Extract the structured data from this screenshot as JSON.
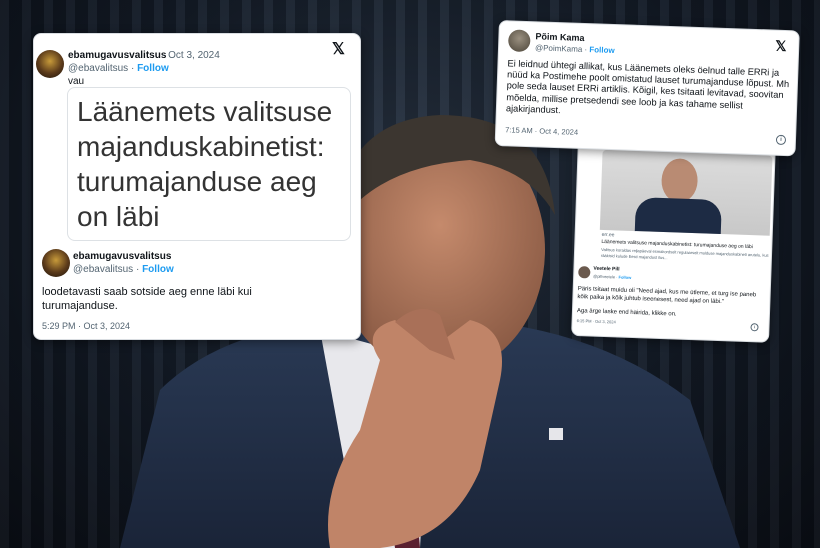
{
  "tweet_left": {
    "name": "ebamugavusvalitsus",
    "date": "Oct 3, 2024",
    "handle": "@ebavalitsus",
    "follow_label": "Follow",
    "text": "vau",
    "embedded_headline": "Läänemets valitsuse majanduskabinetist: turumajanduse aeg on läbi",
    "reply_name": "ebamugavusvalitsus",
    "reply_handle": "@ebavalitsus",
    "reply_follow": "Follow",
    "reply_text": "loodetavasti saab sotside aeg enne läbi kui turumajanduse.",
    "reply_time": "5:29 PM · Oct 3, 2024"
  },
  "tweet_right_top": {
    "name": "Põim Kama",
    "handle": "@PoimKama",
    "follow_label": "Follow",
    "text": "Ei leidnud ühtegi allikat, kus Läänemets oleks öelnud talle ERRi ja nüüd ka Postimehe poolt omistatud lauset turumajanduse lõpust. Mh pole seda lauset ERRi artiklis. Kõigil, kes tsitaati levitavad, soovitan mõelda, millise pretsedendi see loob ja kas tahame sellist ajakirjandust.",
    "time": "7:15 AM · Oct 4, 2024"
  },
  "tweet_right_bottom": {
    "embed_source": "err.ee",
    "embed_title": "Läänemets valitsuse majanduskabinetist: turumajanduse aeg on läbi",
    "embed_desc": "Valitsus koraldas reljapäeval esmakordselt regulaarselt mulduse majanduskabineti arutelu, kus rääkisid kulude Eesti majandust ilus...",
    "quote_name": "Veetele Pill",
    "quote_handle": "@pillveetele",
    "quote_follow": "Follow",
    "quote_text": "Päris tsitaat muidu oli \"Need ajad, kus me ütleme, et turg ise paneb kõik paika ja kõik juhtub iseenesest, need ajad on läbi.\"",
    "quote_text2": "Aga ärge laske end häirida, klikke on.",
    "quote_time": "6:15 PM · Oct 3, 2024"
  },
  "icons": {
    "x_logo": "x-logo-icon",
    "info": "info-icon"
  }
}
